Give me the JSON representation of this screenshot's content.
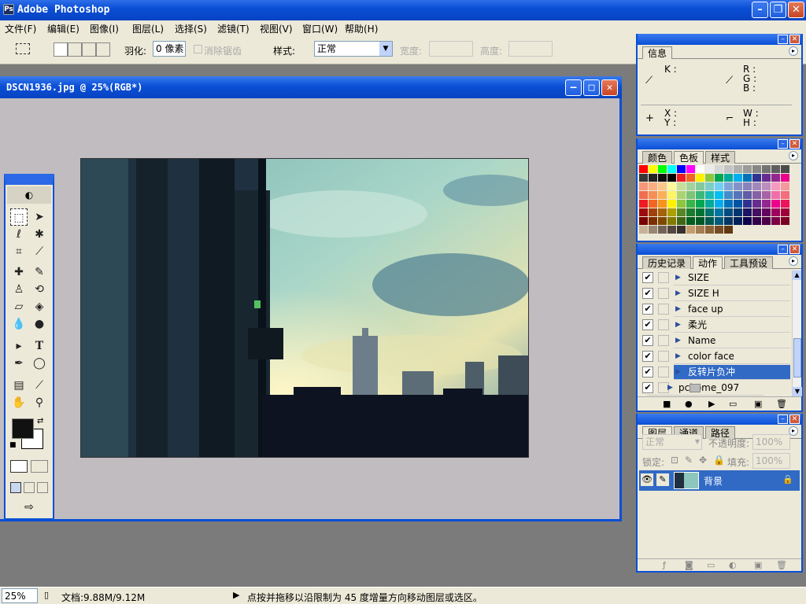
{
  "app": {
    "title": "Adobe Photoshop"
  },
  "menu": [
    "文件(F)",
    "编辑(E)",
    "图像(I)",
    "图层(L)",
    "选择(S)",
    "滤镜(T)",
    "视图(V)",
    "窗口(W)",
    "帮助(H)"
  ],
  "options": {
    "feather_label": "羽化:",
    "feather_value": "0 像素",
    "antialias_label": "消除锯齿",
    "style_label": "样式:",
    "style_value": "正常",
    "width_label": "宽度:",
    "height_label": "高度:"
  },
  "document": {
    "title": "DSCN1936.jpg @ 25%(RGB*)"
  },
  "info_panel": {
    "tab": "信息",
    "k": "K :",
    "r": "R :",
    "g": "G :",
    "b": "B :",
    "x": "X :",
    "y": "Y :",
    "w": "W :",
    "h": "H :"
  },
  "swatches_panel": {
    "tabs": [
      "颜色",
      "色板",
      "样式"
    ],
    "active": 1,
    "rows": [
      [
        "#ff0000",
        "#ffff00",
        "#00ff00",
        "#00ffff",
        "#0000ff",
        "#ff00ff",
        "#ffffff",
        "#ebebeb",
        "#d7d7d7",
        "#c3c3c3",
        "#afafaf",
        "#9b9b9b",
        "#878787",
        "#737373",
        "#5f5f5f",
        "#4b4b4b"
      ],
      [
        "#373737",
        "#232323",
        "#0f0f0f",
        "#000000",
        "#ed1c24",
        "#f26522",
        "#fff200",
        "#8dc63f",
        "#00a651",
        "#00a99d",
        "#00aeef",
        "#0072bc",
        "#2e3192",
        "#662d91",
        "#92278f",
        "#ec008c"
      ],
      [
        "#f7977a",
        "#f9ad81",
        "#fdc68a",
        "#fff79a",
        "#c4df9b",
        "#a3d39c",
        "#82ca9d",
        "#7bcdc8",
        "#6ecff6",
        "#7da7d9",
        "#8393ca",
        "#8882be",
        "#a187be",
        "#bc8dbf",
        "#f49ac2",
        "#f6989d"
      ],
      [
        "#f26c4f",
        "#f68e55",
        "#fbaf5c",
        "#fff467",
        "#acd372",
        "#7cc576",
        "#3bb878",
        "#1abbb4",
        "#00bff3",
        "#438cca",
        "#5574b9",
        "#605ca8",
        "#855fa8",
        "#a763a8",
        "#f06ea9",
        "#f26d7d"
      ],
      [
        "#ed1c24",
        "#f26522",
        "#f7941d",
        "#fff200",
        "#8dc63f",
        "#39b54a",
        "#00a651",
        "#00a99d",
        "#00aeef",
        "#0072bc",
        "#0054a6",
        "#2e3192",
        "#662d91",
        "#92278f",
        "#ec008c",
        "#ed145b"
      ],
      [
        "#9e0b0f",
        "#a0410d",
        "#a36209",
        "#aba000",
        "#598527",
        "#1a7b30",
        "#007236",
        "#00746b",
        "#0076a3",
        "#004b80",
        "#003471",
        "#1b1464",
        "#440e62",
        "#630460",
        "#9e005d",
        "#9e0039"
      ],
      [
        "#790000",
        "#7b2e00",
        "#7d4900",
        "#827b00",
        "#406618",
        "#005e20",
        "#005826",
        "#005952",
        "#005b7f",
        "#003663",
        "#002157",
        "#0d004c",
        "#32004b",
        "#4b0049",
        "#7b0046",
        "#7a0026"
      ],
      [
        "#c7b299",
        "#998675",
        "#736357",
        "#534741",
        "#37302d",
        "#c69c6d",
        "#a67c52",
        "#8c6239",
        "#754c24",
        "#603913",
        "#ece9d8",
        "#ece9d8",
        "#ece9d8",
        "#ece9d8",
        "#ece9d8",
        "#ece9d8"
      ]
    ]
  },
  "actions_panel": {
    "tabs": [
      "历史记录",
      "动作",
      "工具预设"
    ],
    "active": 1,
    "items": [
      {
        "label": "SIZE",
        "checked": true,
        "selected": false,
        "folder": false
      },
      {
        "label": "SIZE H",
        "checked": true,
        "selected": false,
        "folder": false
      },
      {
        "label": "face up",
        "checked": true,
        "selected": false,
        "folder": false
      },
      {
        "label": "柔光",
        "checked": true,
        "selected": false,
        "folder": false
      },
      {
        "label": "Name",
        "checked": true,
        "selected": false,
        "folder": false
      },
      {
        "label": "color face",
        "checked": true,
        "selected": false,
        "folder": false
      },
      {
        "label": "反转片负冲",
        "checked": true,
        "selected": true,
        "folder": false
      },
      {
        "label": "pchome_097",
        "checked": true,
        "selected": false,
        "folder": true
      }
    ]
  },
  "layers_panel": {
    "tabs": [
      "图层",
      "通道",
      "路径"
    ],
    "active": 0,
    "blend": "正常",
    "opacity_label": "不透明度:",
    "opacity": "100%",
    "lock_label": "锁定:",
    "fill_label": "填充:",
    "fill": "100%",
    "layer_name": "背景"
  },
  "status": {
    "zoom": "25%",
    "doc": "文档:9.88M/9.12M",
    "hint": "点按并拖移以沿限制为 45 度增量方向移动图层或选区。"
  },
  "colors": {
    "accent": "#0a4fd6",
    "panel": "#ece9d8",
    "selection": "#316ac5"
  }
}
